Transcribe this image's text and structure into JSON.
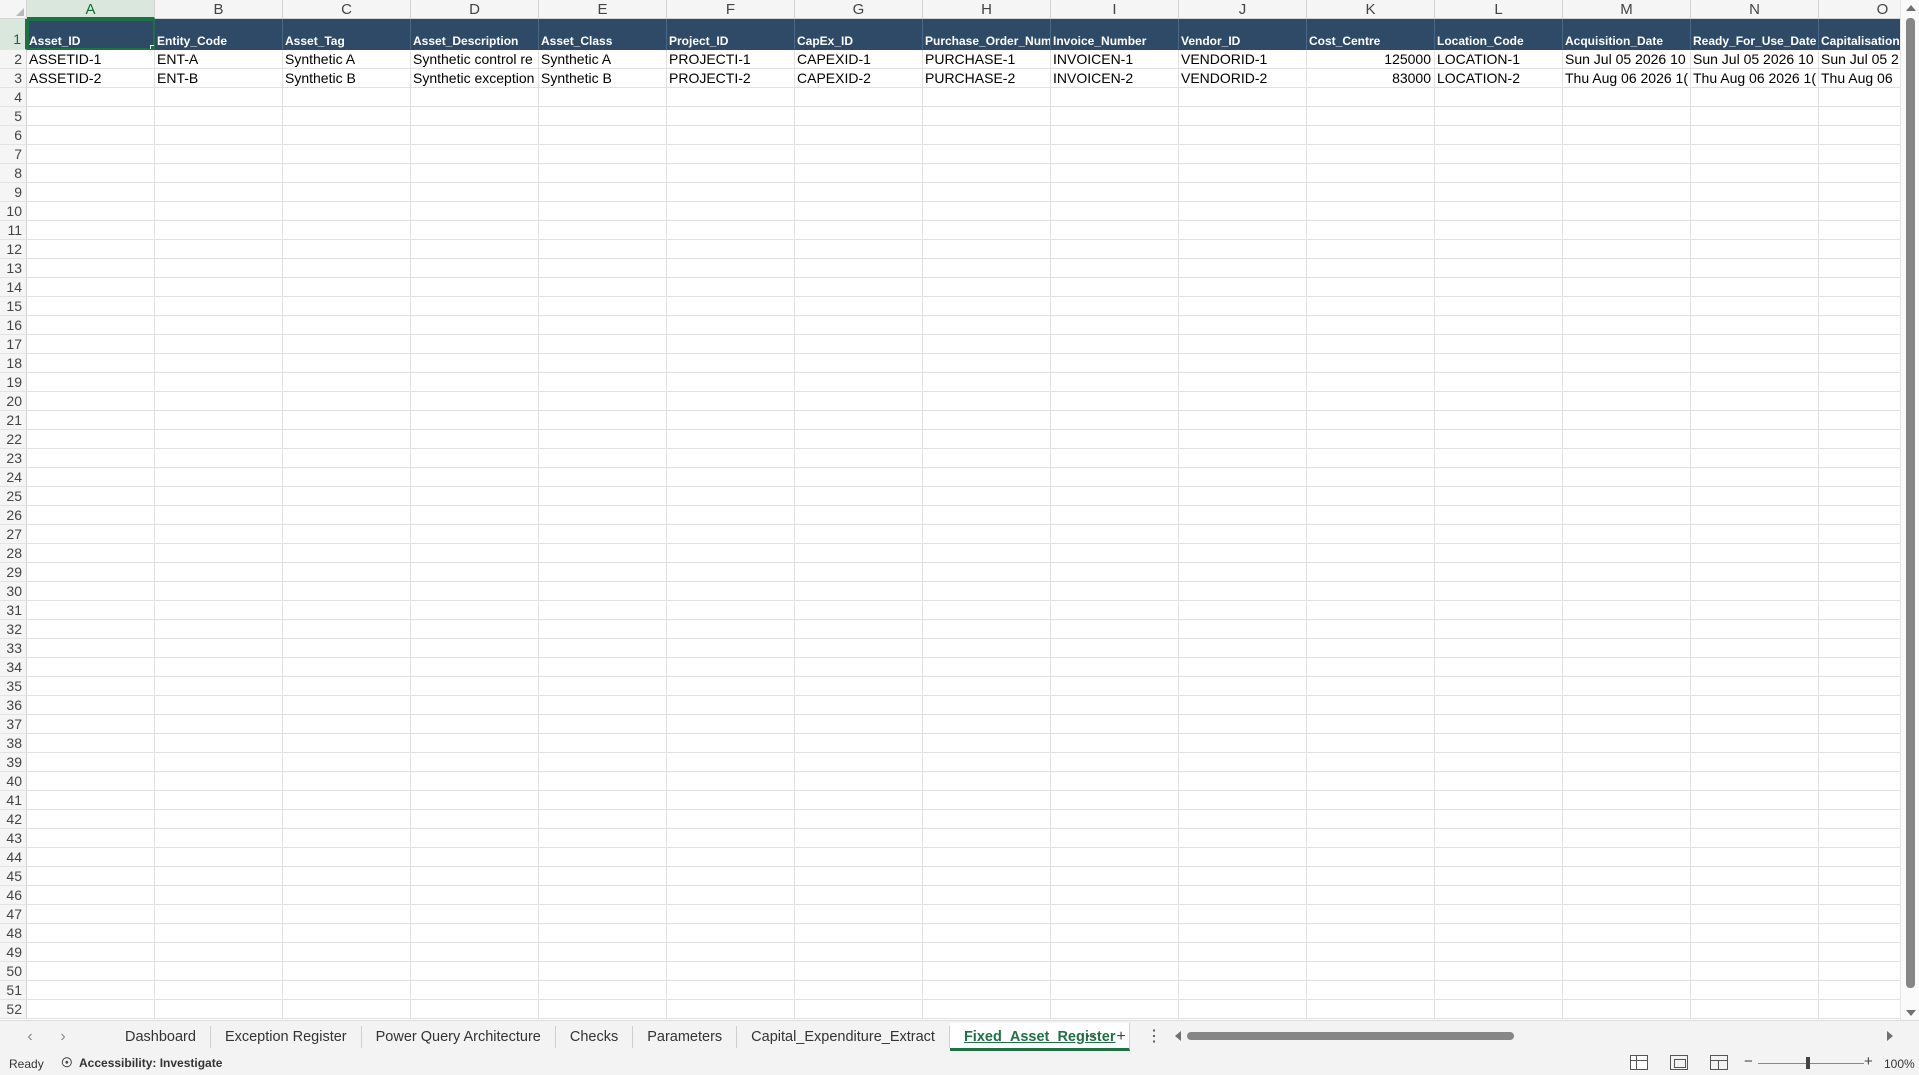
{
  "sheet": {
    "columns": [
      "A",
      "B",
      "C",
      "D",
      "E",
      "F",
      "G",
      "H",
      "I",
      "J",
      "K",
      "L",
      "M",
      "N",
      "O"
    ],
    "selected_column": "A",
    "row_numbers": [
      "1",
      "2",
      "3",
      "4",
      "5",
      "6",
      "7",
      "8",
      "9",
      "10",
      "11",
      "12",
      "13",
      "14",
      "15",
      "16",
      "17",
      "18",
      "19",
      "20",
      "21",
      "22",
      "23",
      "24",
      "25",
      "26",
      "27",
      "28",
      "29",
      "30",
      "31",
      "32",
      "33",
      "34",
      "35",
      "36",
      "37",
      "38",
      "39",
      "40",
      "41",
      "42",
      "43",
      "44",
      "45",
      "46",
      "47",
      "48",
      "49",
      "50",
      "51",
      "52"
    ],
    "selected_row": "1",
    "headers": [
      "Asset_ID",
      "Entity_Code",
      "Asset_Tag",
      "Asset_Description",
      "Asset_Class",
      "Project_ID",
      "CapEx_ID",
      "Purchase_Order_Number",
      "Invoice_Number",
      "Vendor_ID",
      "Cost_Centre",
      "Location_Code",
      "Acquisition_Date",
      "Ready_For_Use_Date",
      "Capitalisation"
    ],
    "rows": [
      [
        "ASSETID-1",
        "ENT-A",
        "Synthetic A",
        "Synthetic control re",
        "Synthetic A",
        "PROJECTI-1",
        "CAPEXID-1",
        "PURCHASE-1",
        "INVOICEN-1",
        "VENDORID-1",
        "125000",
        "LOCATION-1",
        "Sun Jul 05 2026 10",
        "Sun Jul 05 2026 10",
        "Sun Jul 05 2"
      ],
      [
        "ASSETID-2",
        "ENT-B",
        "Synthetic B",
        "Synthetic exception",
        "Synthetic B",
        "PROJECTI-2",
        "CAPEXID-2",
        "PURCHASE-2",
        "INVOICEN-2",
        "VENDORID-2",
        "83000",
        "LOCATION-2",
        "Thu Aug 06 2026 1(",
        "Thu Aug 06 2026 1(",
        "Thu Aug 06"
      ]
    ],
    "numeric_columns": [
      10
    ]
  },
  "tabs": {
    "items": [
      "Dashboard",
      "Exception Register",
      "Power Query Architecture",
      "Checks",
      "Parameters",
      "Capital_Expenditure_Extract",
      "Fixed_Asset_Register"
    ],
    "active": "Fixed_Asset_Register",
    "more_label": "⋯",
    "add_label": "+",
    "menu_label": "⋮"
  },
  "status": {
    "ready": "Ready",
    "accessibility": "Accessibility: Investigate",
    "zoom": "100%"
  },
  "colors": {
    "header_fill": "#2e4a66",
    "selection": "#1e7145"
  }
}
